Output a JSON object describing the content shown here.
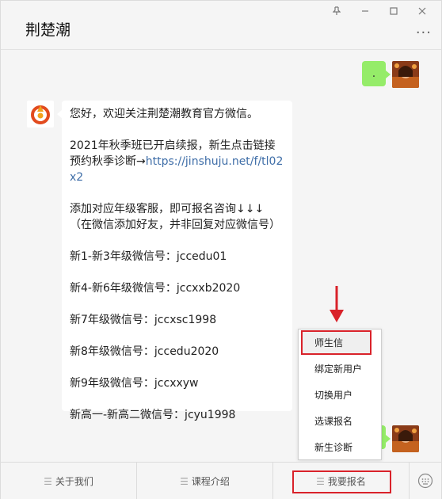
{
  "window": {
    "title": "荆楚潮",
    "controls": [
      "pin-icon",
      "minimize-icon",
      "maximize-icon",
      "close-icon"
    ],
    "more_label": "···"
  },
  "chat": {
    "my_message_text": ".",
    "article": {
      "lines": [
        "您好，欢迎关注荆楚潮教育官方微信。",
        "2021年秋季班已开启续报，新生点击链接预约秋季诊断→",
        "添加对应年级客服，即可报名咨询↓↓↓（在微信添加好友，并非回复对应微信号）",
        "新1-新3年级微信号：jccedu01",
        "新4-新6年级微信号：jccxxb2020",
        "新7年级微信号：jccxsc1998",
        "新8年级微信号：jccedu2020",
        "新9年级微信号：jccxxyw",
        "新高一-新高二微信号：jcyu1998"
      ],
      "link": "https://jinshuju.net/f/tl02x2"
    }
  },
  "popup_menu": {
    "items": [
      "师生信",
      "绑定新用户",
      "切换用户",
      "选课报名",
      "新生诊断"
    ]
  },
  "bottom_menu": {
    "tabs": [
      "关于我们",
      "课程介绍",
      "我要报名"
    ]
  },
  "colors": {
    "accent_red": "#d9222a",
    "bubble_green": "#95ec69",
    "link_blue": "#3f6ea8"
  }
}
